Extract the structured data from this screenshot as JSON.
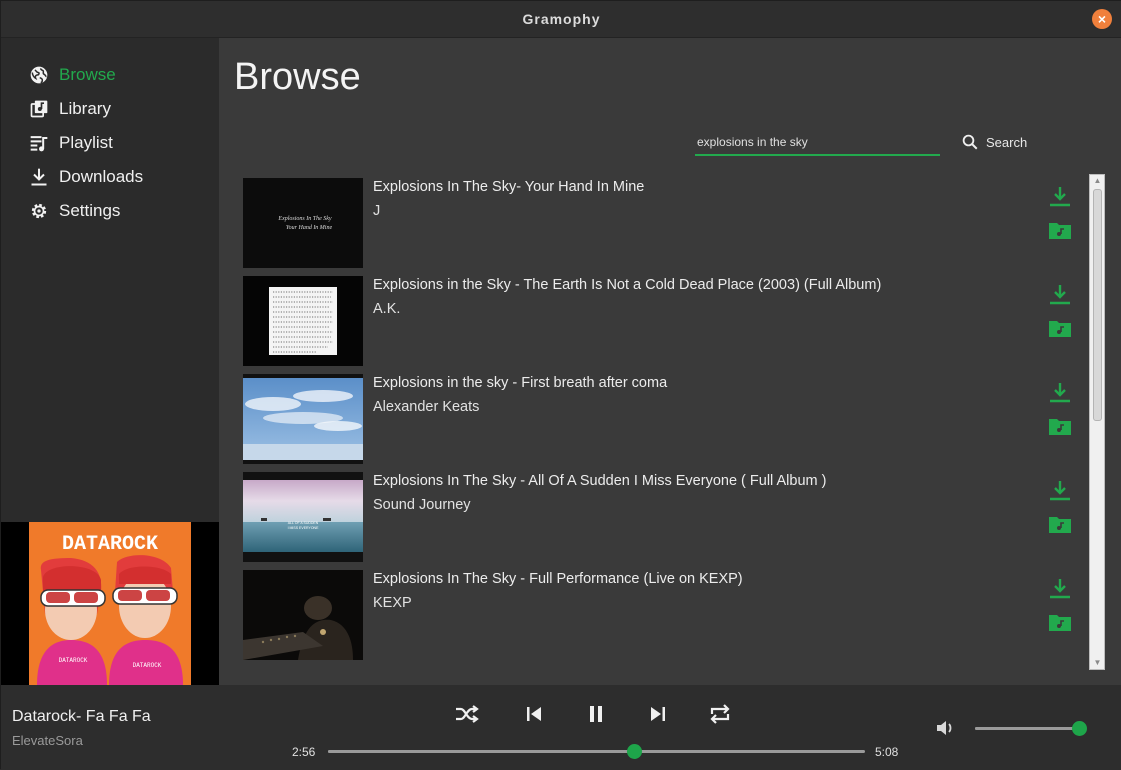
{
  "window": {
    "title": "Gramophy",
    "close_glyph": "×"
  },
  "sidebar": {
    "items": [
      {
        "label": "Browse",
        "icon": "globe-icon",
        "active": true
      },
      {
        "label": "Library",
        "icon": "library-music-icon",
        "active": false
      },
      {
        "label": "Playlist",
        "icon": "playlist-icon",
        "active": false
      },
      {
        "label": "Downloads",
        "icon": "download-icon",
        "active": false
      },
      {
        "label": "Settings",
        "icon": "settings-icon",
        "active": false
      }
    ],
    "album_art": {
      "text": "DATAROCK",
      "shirt_text": "DATAROCK"
    }
  },
  "main": {
    "title": "Browse",
    "search": {
      "value": "explosions in the sky",
      "button_label": "Search"
    },
    "results": [
      {
        "title": "Explosions In The Sky- Your Hand In Mine",
        "channel": "J",
        "thumb_lines": [
          "Explosions In The Sky",
          "Your Hand In Mine"
        ]
      },
      {
        "title": "Explosions in the Sky - The Earth Is Not a Cold Dead Place (2003) (Full Album)",
        "channel": "A.K."
      },
      {
        "title": "Explosions in the sky - First breath after coma",
        "channel": "Alexander Keats"
      },
      {
        "title": "Explosions In The Sky - All Of A Sudden I Miss Everyone ( Full Album )",
        "channel": "Sound Journey",
        "thumb_lines": [
          "ALL OF A SUDDEN",
          "I MISS EVERYONE"
        ]
      },
      {
        "title": "Explosions In The Sky - Full Performance (Live on KEXP)",
        "channel": "KEXP"
      }
    ]
  },
  "player": {
    "now_playing": {
      "title": "Datarock- Fa Fa Fa",
      "artist": "ElevateSora"
    },
    "elapsed": "2:56",
    "duration": "5:08",
    "progress_fraction": 0.571,
    "volume_fraction": 1.0,
    "state": "playing"
  },
  "colors": {
    "accent": "#22a94d",
    "close": "#f0803c",
    "background": "#3a3a3a",
    "sidebar": "#2b2b2b"
  }
}
